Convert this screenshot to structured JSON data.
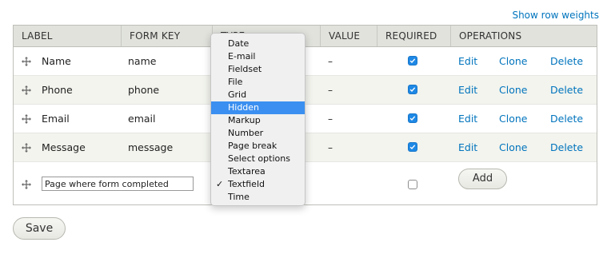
{
  "header_link": "Show row weights",
  "columns": {
    "label": "LABEL",
    "form_key": "FORM KEY",
    "type": "TYPE",
    "value": "VALUE",
    "required": "REQUIRED",
    "operations": "OPERATIONS"
  },
  "rows": [
    {
      "label": "Name",
      "key": "name",
      "value": "–",
      "required": true,
      "edit": "Edit",
      "clone": "Clone",
      "delete": "Delete"
    },
    {
      "label": "Phone",
      "key": "phone",
      "value": "–",
      "required": true,
      "edit": "Edit",
      "clone": "Clone",
      "delete": "Delete"
    },
    {
      "label": "Email",
      "key": "email",
      "value": "–",
      "required": true,
      "edit": "Edit",
      "clone": "Clone",
      "delete": "Delete"
    },
    {
      "label": "Message",
      "key": "message",
      "value": "–",
      "required": true,
      "edit": "Edit",
      "clone": "Clone",
      "delete": "Delete"
    }
  ],
  "new_row": {
    "label_value": "Page where form completed",
    "required": false,
    "add_label": "Add"
  },
  "type_dropdown": {
    "options": [
      "Date",
      "E-mail",
      "Fieldset",
      "File",
      "Grid",
      "Hidden",
      "Markup",
      "Number",
      "Page break",
      "Select options",
      "Textarea",
      "Textfield",
      "Time"
    ],
    "highlighted": "Hidden",
    "checked": "Textfield",
    "check_glyph": "✓"
  },
  "save_label": "Save",
  "colors": {
    "link": "#0074bd",
    "header_bg": "#e1e2dc",
    "alt_row_bg": "#f3f4ee",
    "checkbox_on": "#1e88e5",
    "menu_highlight": "#3b8ff0"
  },
  "icons": {
    "drag_handle": "drag-handle-icon",
    "checkmark": "checkmark-icon"
  }
}
